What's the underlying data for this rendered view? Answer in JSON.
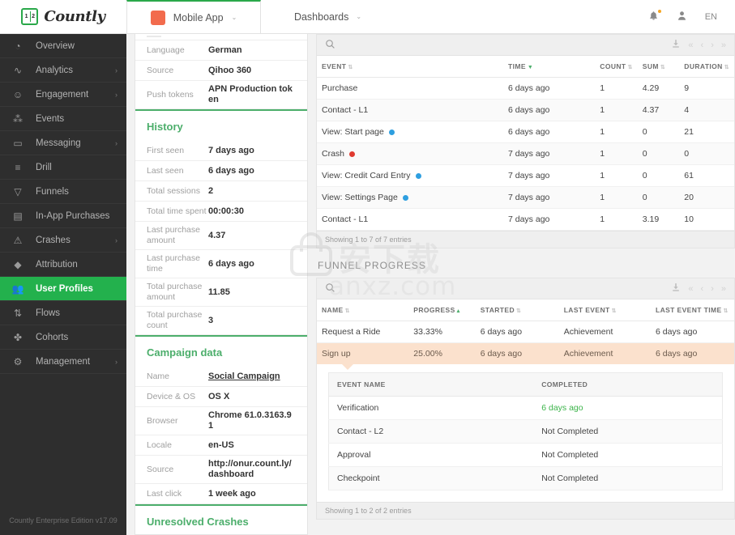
{
  "topbar": {
    "logo_line1": "1",
    "logo_line2": "2",
    "logo_text": "Countly",
    "app_tab": "Mobile App",
    "dashboards_tab": "Dashboards",
    "caret": "⌄",
    "bell_icon": "🔔",
    "user_icon": "👤",
    "language": "EN",
    "accent_green": "#2aa84a",
    "app_color": "#f26b4d"
  },
  "sidebar": {
    "items": [
      {
        "label": "Overview",
        "icon": "◔",
        "arrow": "",
        "active": false
      },
      {
        "label": "Analytics",
        "icon": "∿",
        "arrow": "›",
        "active": false
      },
      {
        "label": "Engagement",
        "icon": "☺",
        "arrow": "›",
        "active": false
      },
      {
        "label": "Events",
        "icon": "⁂",
        "arrow": "",
        "active": false
      },
      {
        "label": "Messaging",
        "icon": "▭",
        "arrow": "›",
        "active": false
      },
      {
        "label": "Drill",
        "icon": "≡",
        "arrow": "",
        "active": false
      },
      {
        "label": "Funnels",
        "icon": "▽",
        "arrow": "",
        "active": false
      },
      {
        "label": "In-App Purchases",
        "icon": "▤",
        "arrow": "",
        "active": false
      },
      {
        "label": "Crashes",
        "icon": "⚠",
        "arrow": "›",
        "active": false
      },
      {
        "label": "Attribution",
        "icon": "◆",
        "arrow": "",
        "active": false
      },
      {
        "label": "User Profiles",
        "icon": "👥",
        "arrow": "",
        "active": true
      },
      {
        "label": "Flows",
        "icon": "⇅",
        "arrow": "",
        "active": false
      },
      {
        "label": "Cohorts",
        "icon": "✤",
        "arrow": "",
        "active": false
      },
      {
        "label": "Management",
        "icon": "⚙",
        "arrow": "›",
        "active": false
      }
    ],
    "footer": "Countly Enterprise Edition v17.09"
  },
  "detail": {
    "top_rows": [
      {
        "label": "Language",
        "value": "German"
      },
      {
        "label": "Source",
        "value": "Qihoo 360"
      },
      {
        "label": "Push tokens",
        "value": "APN Production token"
      }
    ],
    "history_title": "History",
    "history_rows": [
      {
        "label": "First seen",
        "value": "7 days ago"
      },
      {
        "label": "Last seen",
        "value": "6 days ago"
      },
      {
        "label": "Total sessions",
        "value": "2"
      },
      {
        "label": "Total time spent",
        "value": "00:00:30"
      },
      {
        "label": "Last purchase amount",
        "value": "4.37"
      },
      {
        "label": "Last purchase time",
        "value": "6 days ago"
      },
      {
        "label": "Total purchase amount",
        "value": "11.85"
      },
      {
        "label": "Total purchase count",
        "value": "3"
      }
    ],
    "campaign_title": "Campaign data",
    "campaign_rows": [
      {
        "label": "Name",
        "value": "Social Campaign",
        "link": true
      },
      {
        "label": "Device & OS",
        "value": "OS X",
        "link": false
      },
      {
        "label": "Browser",
        "value": "Chrome 61.0.3163.91",
        "link": false
      },
      {
        "label": "Locale",
        "value": "en-US",
        "link": false
      },
      {
        "label": "Source",
        "value": "http://onur.count.ly/dashboard",
        "link": false
      },
      {
        "label": "Last click",
        "value": "1 week ago",
        "link": false
      }
    ],
    "crashes_title": "Unresolved Crashes"
  },
  "events_table": {
    "search_placeholder": "",
    "download_icon": "⤓",
    "pager": [
      "«",
      "‹",
      "›",
      "»"
    ],
    "columns": [
      "EVENT",
      "TIME",
      "COUNT",
      "SUM",
      "DURATION"
    ],
    "sorted_column": "TIME",
    "rows": [
      {
        "event": "Purchase",
        "dot": "",
        "time": "6 days ago",
        "count": "1",
        "sum": "4.29",
        "duration": "9"
      },
      {
        "event": "Contact - L1",
        "dot": "",
        "time": "6 days ago",
        "count": "1",
        "sum": "4.37",
        "duration": "4"
      },
      {
        "event": "View: Start page",
        "dot": "#2e9fe0",
        "time": "6 days ago",
        "count": "1",
        "sum": "0",
        "duration": "21"
      },
      {
        "event": "Crash",
        "dot": "#e03a30",
        "time": "7 days ago",
        "count": "1",
        "sum": "0",
        "duration": "0"
      },
      {
        "event": "View: Credit Card Entry",
        "dot": "#2e9fe0",
        "time": "7 days ago",
        "count": "1",
        "sum": "0",
        "duration": "61"
      },
      {
        "event": "View: Settings Page",
        "dot": "#2e9fe0",
        "time": "7 days ago",
        "count": "1",
        "sum": "0",
        "duration": "20"
      },
      {
        "event": "Contact - L1",
        "dot": "",
        "time": "7 days ago",
        "count": "1",
        "sum": "3.19",
        "duration": "10"
      }
    ],
    "footer": "Showing 1 to 7 of 7 entries"
  },
  "funnel": {
    "section_title": "FUNNEL PROGRESS",
    "download_icon": "⤓",
    "pager": [
      "«",
      "‹",
      "›",
      "»"
    ],
    "columns": [
      "NAME",
      "PROGRESS",
      "STARTED",
      "LAST EVENT",
      "LAST EVENT TIME"
    ],
    "sorted_column": "PROGRESS",
    "rows": [
      {
        "name": "Request a Ride",
        "progress": "33.33%",
        "started": "6 days ago",
        "last_event": "Achievement",
        "last_event_time": "6 days ago",
        "expanded": false
      },
      {
        "name": "Sign up",
        "progress": "25.00%",
        "started": "6 days ago",
        "last_event": "Achievement",
        "last_event_time": "6 days ago",
        "expanded": true
      }
    ],
    "sub_columns": [
      "EVENT NAME",
      "COMPLETED"
    ],
    "sub_rows": [
      {
        "event_name": "Verification",
        "completed": "6 days ago",
        "done": true
      },
      {
        "event_name": "Contact - L2",
        "completed": "Not Completed",
        "done": false
      },
      {
        "event_name": "Approval",
        "completed": "Not Completed",
        "done": false
      },
      {
        "event_name": "Checkpoint",
        "completed": "Not Completed",
        "done": false
      }
    ],
    "footer": "Showing 1 to 2 of 2 entries",
    "highlight_color": "#fbe1cd"
  },
  "watermark": {
    "text1": "安下载",
    "text2": "anxz.com"
  }
}
